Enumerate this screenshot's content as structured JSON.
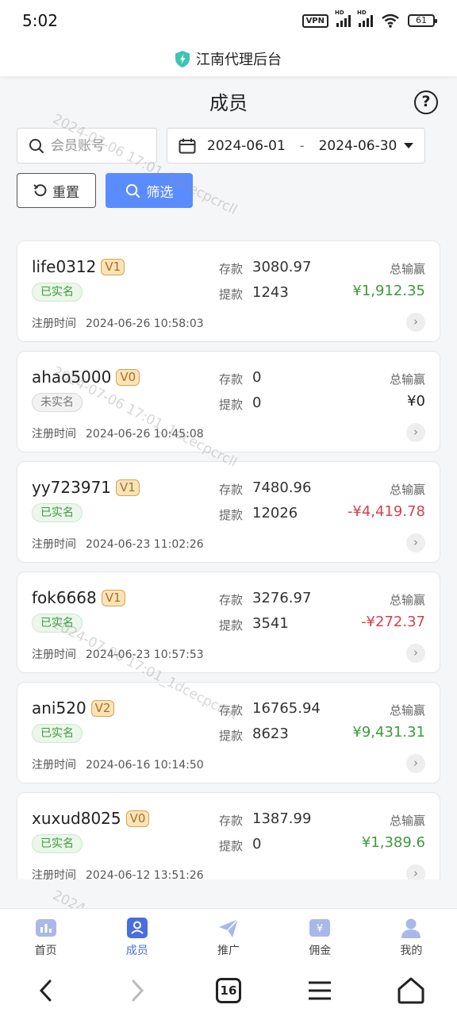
{
  "status_bar": {
    "time": "5:02",
    "vpn": "VPN",
    "battery": "61"
  },
  "app": {
    "title": "江南代理后台"
  },
  "page": {
    "title": "成员",
    "help": "?"
  },
  "filters": {
    "search_placeholder": "会员账号",
    "date_start": "2024-06-01",
    "date_sep": "-",
    "date_end": "2024-06-30",
    "reset_label": "重置",
    "filter_label": "筛选"
  },
  "labels": {
    "deposit": "存款",
    "withdraw": "提款",
    "total": "总输赢",
    "register": "注册时间"
  },
  "members": [
    {
      "username": "life0312",
      "level": "V1",
      "verified": "已实名",
      "deposit": "3080.97",
      "withdraw": "1243",
      "total": "¥1,912.35",
      "register_time": "2024-06-26 10:58:03"
    },
    {
      "username": "ahao5000",
      "level": "V0",
      "verified": "未实名",
      "deposit": "0",
      "withdraw": "0",
      "total": "¥0",
      "register_time": "2024-06-26 10:45:08"
    },
    {
      "username": "yy723971",
      "level": "V1",
      "verified": "已实名",
      "deposit": "7480.96",
      "withdraw": "12026",
      "total": "-¥4,419.78",
      "register_time": "2024-06-23 11:02:26"
    },
    {
      "username": "fok6668",
      "level": "V1",
      "verified": "已实名",
      "deposit": "3276.97",
      "withdraw": "3541",
      "total": "-¥272.37",
      "register_time": "2024-06-23 10:57:53"
    },
    {
      "username": "ani520",
      "level": "V2",
      "verified": "已实名",
      "deposit": "16765.94",
      "withdraw": "8623",
      "total": "¥9,431.31",
      "register_time": "2024-06-16 10:14:50"
    },
    {
      "username": "xuxud8025",
      "level": "V0",
      "verified": "已实名",
      "deposit": "1387.99",
      "withdraw": "0",
      "total": "¥1,389.6",
      "register_time": "2024-06-12 13:51:26"
    }
  ],
  "watermarks": [
    "2024-07-06 17:01_1dcecpcrcll",
    "2024-07-06 17:01_1dcecpcrcll",
    "2024-07-06 17:01_1dcecpcrcll",
    "2024"
  ],
  "tabbar": [
    {
      "label": "首页",
      "icon": "home-chart-icon"
    },
    {
      "label": "成员",
      "icon": "member-icon"
    },
    {
      "label": "推广",
      "icon": "paper-plane-icon"
    },
    {
      "label": "佣金",
      "icon": "commission-icon"
    },
    {
      "label": "我的",
      "icon": "profile-icon"
    }
  ],
  "sysnav": {
    "tabs_count": "16"
  },
  "colors": {
    "positive": "#3e9a3e",
    "negative": "#d2424f",
    "neutral": "#222222",
    "accent": "#5b8cff"
  }
}
